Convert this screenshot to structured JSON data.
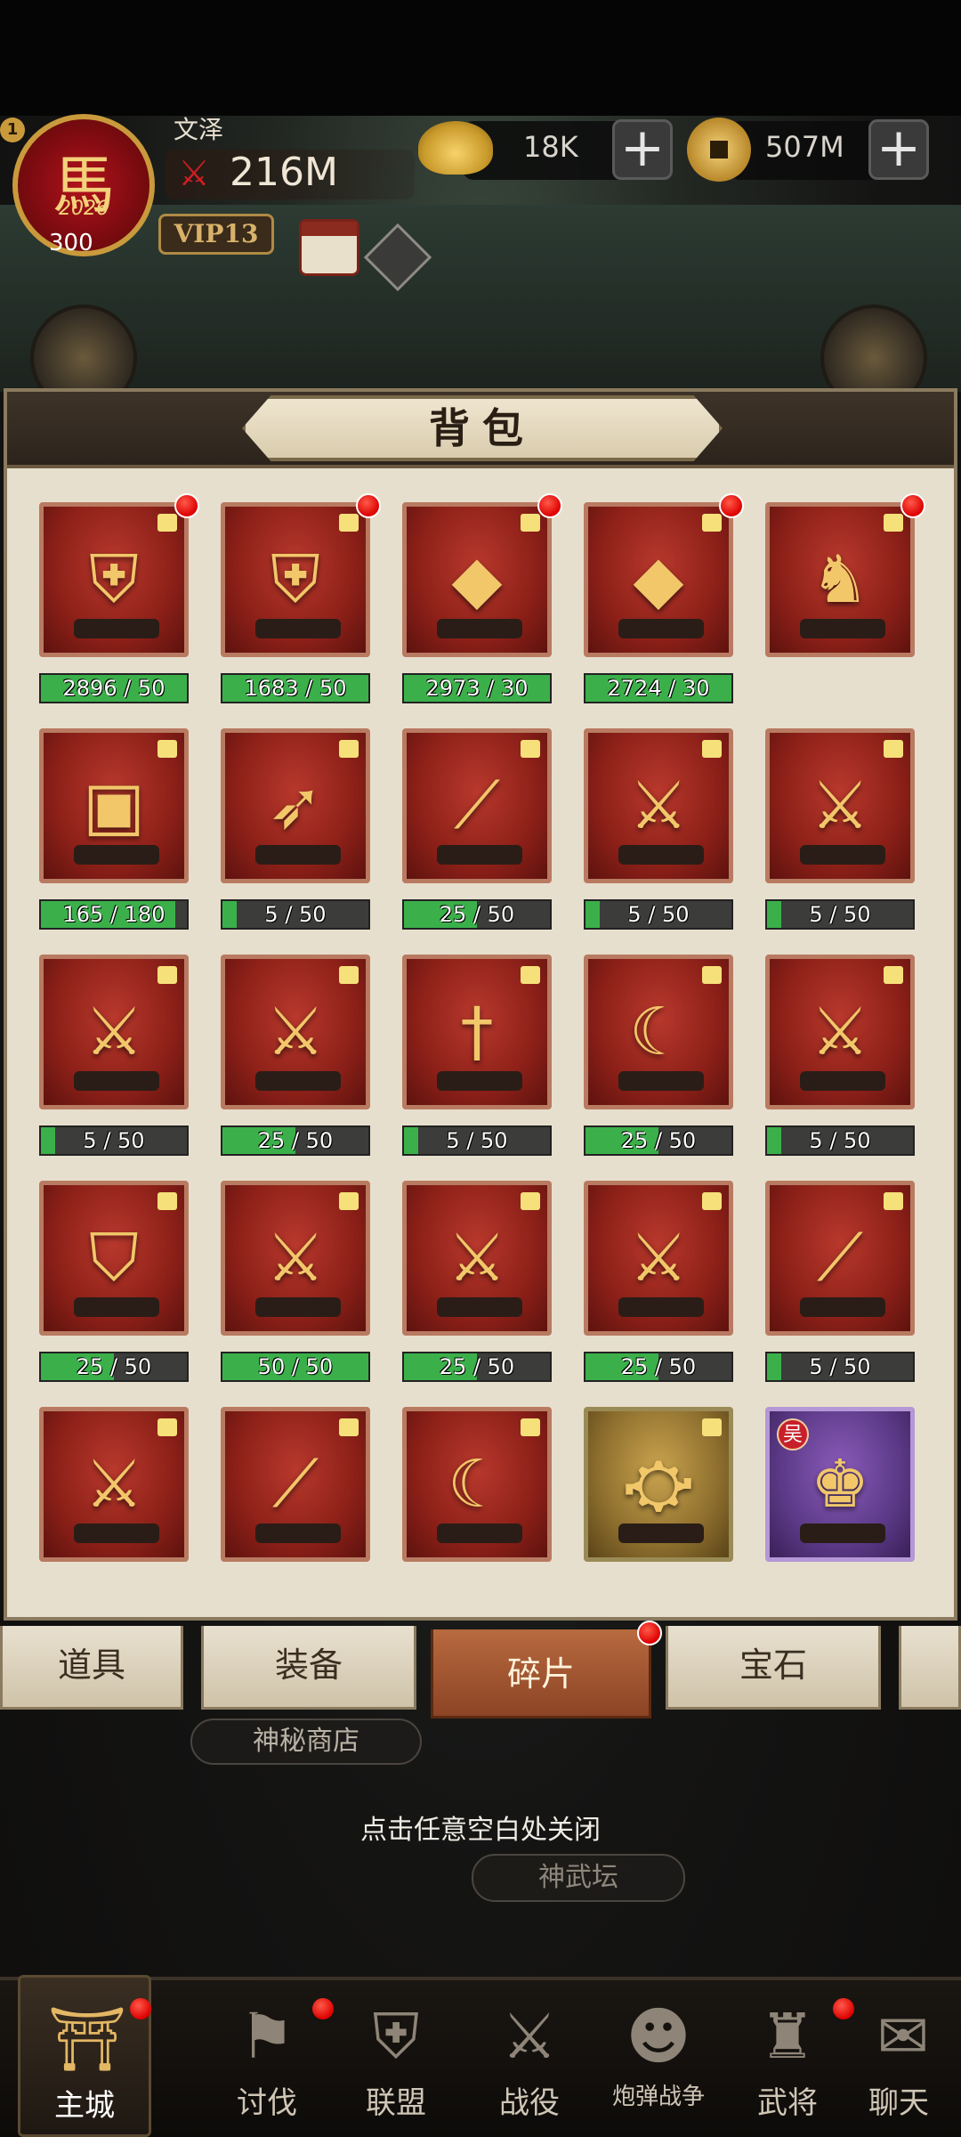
{
  "header": {
    "avatar_glyph": "馬",
    "avatar_year": "2026",
    "level_badge": "1",
    "level_num": "300",
    "player_name": "文泽",
    "power_value": "216M",
    "vip": "VIP13",
    "currency_ingot": "18K",
    "currency_coin": "507M",
    "plus_label": "+"
  },
  "panel": {
    "title": "背包"
  },
  "items": [
    {
      "icon": "golden-armor-icon",
      "art": "⛨",
      "progress_text": "2896 / 50",
      "progress": 1.0,
      "dot": true,
      "style": "red"
    },
    {
      "icon": "red-armor-icon",
      "art": "⛨",
      "progress_text": "1683 / 50",
      "progress": 1.0,
      "dot": true,
      "style": "red"
    },
    {
      "icon": "red-crystal-icon",
      "art": "◆",
      "progress_text": "2973 / 30",
      "progress": 1.0,
      "dot": true,
      "style": "red"
    },
    {
      "icon": "gold-crystal-icon",
      "art": "◆",
      "progress_text": "2724 / 30",
      "progress": 1.0,
      "dot": true,
      "style": "red"
    },
    {
      "icon": "hero-card-icon",
      "art": "♞",
      "progress_text": "",
      "progress": 0,
      "dot": true,
      "style": "red"
    },
    {
      "icon": "treasure-chest-fragment-icon",
      "art": "▣",
      "progress_text": "165 / 180",
      "progress": 0.92,
      "dot": false,
      "style": "red"
    },
    {
      "icon": "bow-icon",
      "art": "➶",
      "progress_text": "5 / 50",
      "progress": 0.1,
      "dot": false,
      "style": "red"
    },
    {
      "icon": "spear-icon",
      "art": "⟋",
      "progress_text": "25 / 50",
      "progress": 0.5,
      "dot": false,
      "style": "red"
    },
    {
      "icon": "halberd-icon",
      "art": "⚔",
      "progress_text": "5 / 50",
      "progress": 0.1,
      "dot": false,
      "style": "red"
    },
    {
      "icon": "sword-icon",
      "art": "⚔",
      "progress_text": "5 / 50",
      "progress": 0.1,
      "dot": false,
      "style": "red"
    },
    {
      "icon": "twin-blades-icon",
      "art": "⚔",
      "progress_text": "5 / 50",
      "progress": 0.1,
      "dot": false,
      "style": "red"
    },
    {
      "icon": "crossed-swords-icon",
      "art": "⚔",
      "progress_text": "25 / 50",
      "progress": 0.5,
      "dot": false,
      "style": "red"
    },
    {
      "icon": "dagger-icon",
      "art": "†",
      "progress_text": "5 / 50",
      "progress": 0.1,
      "dot": false,
      "style": "red"
    },
    {
      "icon": "crescent-blade-icon",
      "art": "☾",
      "progress_text": "25 / 50",
      "progress": 0.5,
      "dot": false,
      "style": "red"
    },
    {
      "icon": "dragon-blade-icon",
      "art": "⚔",
      "progress_text": "5 / 50",
      "progress": 0.1,
      "dot": false,
      "style": "red"
    },
    {
      "icon": "golden-shield-icon",
      "art": "⛉",
      "progress_text": "25 / 50",
      "progress": 0.5,
      "dot": false,
      "style": "red"
    },
    {
      "icon": "broadsword-icon",
      "art": "⚔",
      "progress_text": "50 / 50",
      "progress": 1.0,
      "dot": false,
      "style": "red"
    },
    {
      "icon": "twin-whips-icon",
      "art": "⚔",
      "progress_text": "25 / 50",
      "progress": 0.5,
      "dot": false,
      "style": "red"
    },
    {
      "icon": "crossed-glaives-icon",
      "art": "⚔",
      "progress_text": "25 / 50",
      "progress": 0.5,
      "dot": false,
      "style": "red"
    },
    {
      "icon": "trident-icon",
      "art": "⟋",
      "progress_text": "5 / 50",
      "progress": 0.1,
      "dot": false,
      "style": "red"
    },
    {
      "icon": "ornate-sword-icon",
      "art": "⚔",
      "progress_text": "",
      "progress": 0,
      "dot": false,
      "style": "red"
    },
    {
      "icon": "long-spear-icon",
      "art": "⟋",
      "progress_text": "",
      "progress": 0,
      "dot": false,
      "style": "red"
    },
    {
      "icon": "crescent-halberd-icon",
      "art": "☾",
      "progress_text": "",
      "progress": 0,
      "dot": false,
      "style": "red"
    },
    {
      "icon": "weapon-rack-icon",
      "art": "⛮",
      "progress_text": "",
      "progress": 0,
      "dot": false,
      "style": "gold"
    },
    {
      "icon": "general-portrait-icon",
      "art": "♚",
      "progress_text": "",
      "progress": 0,
      "dot": false,
      "style": "purple",
      "faction": "吴"
    }
  ],
  "tabs": [
    {
      "label": "道具",
      "active": false
    },
    {
      "label": "装备",
      "active": false
    },
    {
      "label": "碎片",
      "active": true
    },
    {
      "label": "宝石",
      "active": false
    }
  ],
  "overlay": {
    "mystery_shop": "神秘商店",
    "close_hint": "点击任意空白处关闭",
    "altar": "神武坛"
  },
  "nav": [
    {
      "label": "主城",
      "icon": "city-gate-icon",
      "glyph": "⛩",
      "active": true,
      "dot": true
    },
    {
      "label": "讨伐",
      "icon": "flag-icon",
      "glyph": "⚑",
      "active": false,
      "dot": true
    },
    {
      "label": "联盟",
      "icon": "shield-icon",
      "glyph": "⛨",
      "active": false,
      "dot": false
    },
    {
      "label": "战役",
      "icon": "crossed-swords-icon",
      "glyph": "⚔",
      "active": false,
      "dot": false
    },
    {
      "label": "炮弹战争",
      "icon": "cannonball-icon",
      "glyph": "☻",
      "active": false,
      "dot": false
    },
    {
      "label": "武将",
      "icon": "helmet-icon",
      "glyph": "♜",
      "active": false,
      "dot": true
    },
    {
      "label": "聊天",
      "icon": "chat-icon",
      "glyph": "✉",
      "active": false,
      "dot": false
    }
  ]
}
